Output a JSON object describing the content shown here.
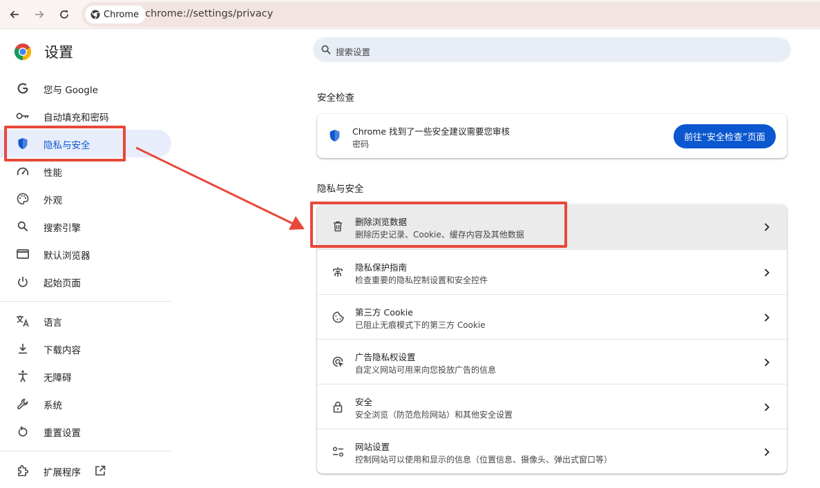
{
  "browser": {
    "site_chip": "Chrome",
    "url": "chrome://settings/privacy"
  },
  "sidebar": {
    "title": "设置",
    "items": [
      {
        "label": "您与 Google",
        "icon": "google-icon"
      },
      {
        "label": "自动填充和密码",
        "icon": "key-icon"
      },
      {
        "label": "隐私与安全",
        "icon": "shield-icon",
        "active": true
      },
      {
        "label": "性能",
        "icon": "speedometer-icon"
      },
      {
        "label": "外观",
        "icon": "palette-icon"
      },
      {
        "label": "搜索引擎",
        "icon": "search-icon"
      },
      {
        "label": "默认浏览器",
        "icon": "browser-window-icon"
      },
      {
        "label": "起始页面",
        "icon": "power-icon"
      },
      {
        "label": "语言",
        "icon": "translate-icon"
      },
      {
        "label": "下载内容",
        "icon": "download-icon"
      },
      {
        "label": "无障碍",
        "icon": "accessibility-icon"
      },
      {
        "label": "系统",
        "icon": "wrench-icon"
      },
      {
        "label": "重置设置",
        "icon": "reset-icon"
      },
      {
        "label": "扩展程序",
        "icon": "extension-icon"
      }
    ]
  },
  "search": {
    "placeholder": "搜索设置"
  },
  "safety_check": {
    "section_title": "安全检查",
    "title": "Chrome 找到了一些安全建议需要您审核",
    "subtitle": "密码",
    "button": "前往“安全检查”页面"
  },
  "privacy": {
    "section_title": "隐私与安全",
    "rows": [
      {
        "title": "删除浏览数据",
        "subtitle": "删除历史记录、Cookie、缓存内容及其他数据",
        "icon": "trash-icon"
      },
      {
        "title": "隐私保护指南",
        "subtitle": "检查重要的隐私控制设置和安全控件",
        "icon": "privacy-guide-icon"
      },
      {
        "title": "第三方 Cookie",
        "subtitle": "已阻止无痕模式下的第三方 Cookie",
        "icon": "cookie-icon"
      },
      {
        "title": "广告隐私权设置",
        "subtitle": "自定义网站可用来向您投放广告的信息",
        "icon": "ads-click-icon"
      },
      {
        "title": "安全",
        "subtitle": "安全浏览（防范危险网站）和其他安全设置",
        "icon": "lock-icon"
      },
      {
        "title": "网站设置",
        "subtitle": "控制网站可以使用和显示的信息（位置信息、摄像头、弹出式窗口等）",
        "icon": "tune-icon"
      }
    ]
  },
  "colors": {
    "accent": "#0b57d0",
    "annotation": "#e8483c",
    "active_nav_bg": "#e8edfb"
  }
}
